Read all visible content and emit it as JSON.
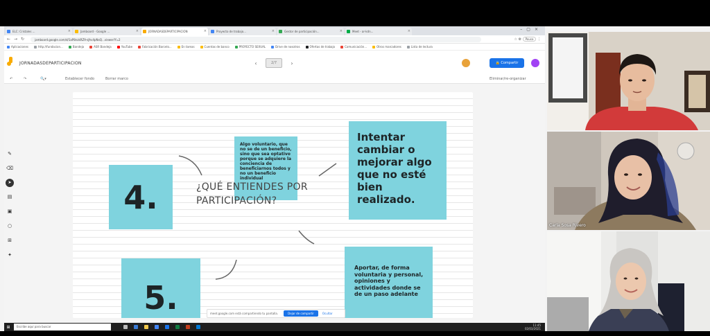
{
  "browser": {
    "tabs": [
      {
        "label": "ELC: Cristales ...",
        "active": false
      },
      {
        "label": "Jamboard - Google ...",
        "active": false
      },
      {
        "label": "JORNADASDEPARTICIPACION",
        "active": true
      },
      {
        "label": "Proyecto de trabajo...",
        "active": false
      },
      {
        "label": "Gestor de participación...",
        "active": false
      },
      {
        "label": "Meet - ar-kdn...",
        "active": false
      }
    ],
    "url": "jamboard.google.com/d/1aP8nzkRZ9-sJhv4pNxQ...viewer?f=2",
    "address_right": "Pausa",
    "bookmarks": [
      {
        "label": "Aplicaciones",
        "color": "#4285f4"
      },
      {
        "label": "http://fundacion...",
        "color": "#9aa0a6"
      },
      {
        "label": "Bandeja",
        "color": "#34a853"
      },
      {
        "label": "ASR Bandeja",
        "color": "#ea4335"
      },
      {
        "label": "YouTube",
        "color": "#ff0000"
      },
      {
        "label": "Fabricación Barcelo...",
        "color": "#ea4335"
      },
      {
        "label": "En tareas",
        "color": "#fbbc05"
      },
      {
        "label": "Cuentas de banco",
        "color": "#fbbc05"
      },
      {
        "label": "PROYECTO SEXUAL",
        "color": "#34a853"
      },
      {
        "label": "Drive de nosotros",
        "color": "#4285f4"
      },
      {
        "label": "Ofertas de trabajo",
        "color": "#202124"
      },
      {
        "label": "Comunicación...",
        "color": "#ea4335"
      },
      {
        "label": "Otros marcadores",
        "color": "#fbbc05"
      },
      {
        "label": "Lista de lectura",
        "color": "#9aa0a6"
      }
    ]
  },
  "jamboard": {
    "title": "JORNADASDEPARTICIPACION",
    "frame_label": "2/7",
    "share_label": "Compartir",
    "toolbar_left": "Establecer fondo",
    "toolbar_mid": "Borrar marco",
    "toolbar_right": "Eliminar/re-organizar"
  },
  "board": {
    "question": "¿QUÉ ENTIENDES POR PARTICIPACIÓN?",
    "notes": [
      {
        "id": "num4",
        "text": "4."
      },
      {
        "id": "num5",
        "text": "5."
      },
      {
        "id": "small",
        "text": "Algo voluntario, que no se de un beneficio, sino que sea optativo porque se adquiere la conciencia de beneficiarnos todos y no un beneficio individual"
      },
      {
        "id": "large",
        "text": "Intentar cambiar o mejorar algo que no esté bien realizado."
      },
      {
        "id": "medium",
        "text": "Aportar, de forma voluntaria y personal, opiniones y actividades donde se de un paso adelante"
      }
    ],
    "note_color": "#7fd3de"
  },
  "share_bar": {
    "message": "meet.google.com está compartiendo tu pantalla.",
    "stop_label": "Dejar de compartir",
    "hide_label": "Ocultar"
  },
  "taskbar": {
    "search_placeholder": "Escribe aquí para buscar",
    "time": "11:45",
    "date": "02/03/2021"
  },
  "participants": [
    {
      "name": ""
    },
    {
      "name": "Carla Sosa Rivero"
    },
    {
      "name": ""
    }
  ]
}
